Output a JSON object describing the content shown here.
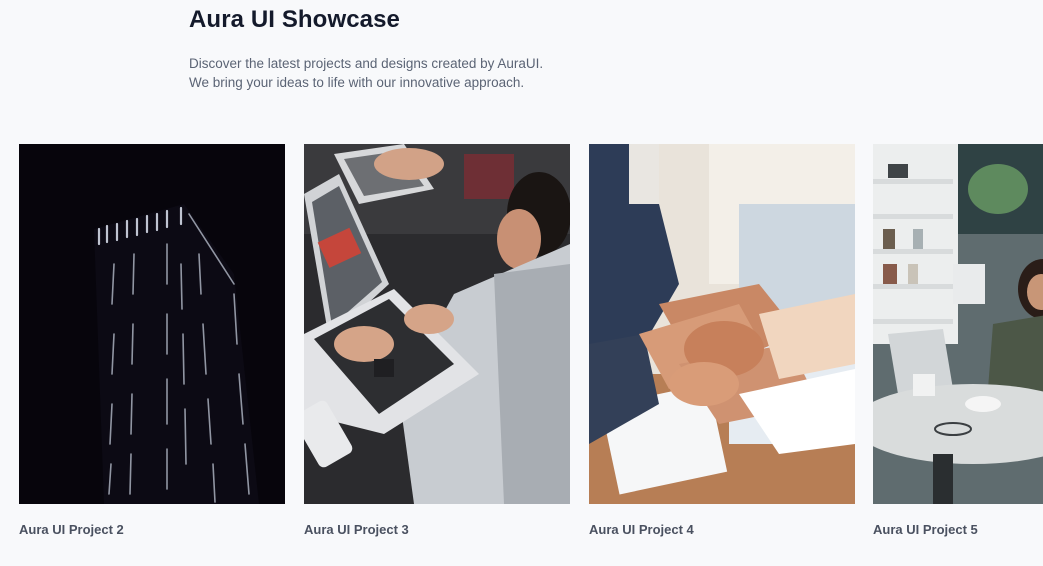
{
  "header": {
    "title": "Aura UI Showcase",
    "subtitle_line1": "Discover the latest projects and designs created by AuraUI.",
    "subtitle_line2": "We bring your ideas to life with our innovative approach."
  },
  "projects": [
    {
      "title": "Aura UI Project 2",
      "image": "night-skyscraper-photo"
    },
    {
      "title": "Aura UI Project 3",
      "image": "people-on-laptops-photo"
    },
    {
      "title": "Aura UI Project 4",
      "image": "stacked-hands-teamwork-photo"
    },
    {
      "title": "Aura UI Project 5",
      "image": "woman-in-cafe-laptop-photo"
    }
  ]
}
